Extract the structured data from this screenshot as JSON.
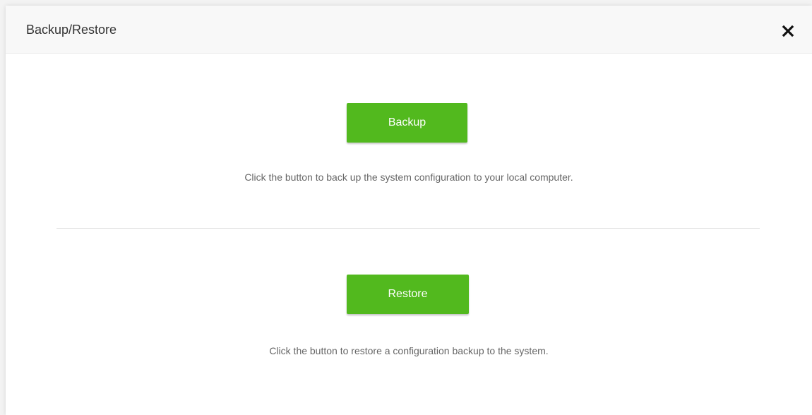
{
  "dialog": {
    "title": "Backup/Restore",
    "close_icon": "close-icon"
  },
  "backup": {
    "button_label": "Backup",
    "description": "Click the button to back up the system configuration to your local computer."
  },
  "restore": {
    "button_label": "Restore",
    "description": "Click the button to restore a configuration backup to the system."
  },
  "colors": {
    "accent": "#52b91e",
    "header_bg": "#f8f8f8",
    "text": "#333333",
    "muted_text": "#666666"
  }
}
